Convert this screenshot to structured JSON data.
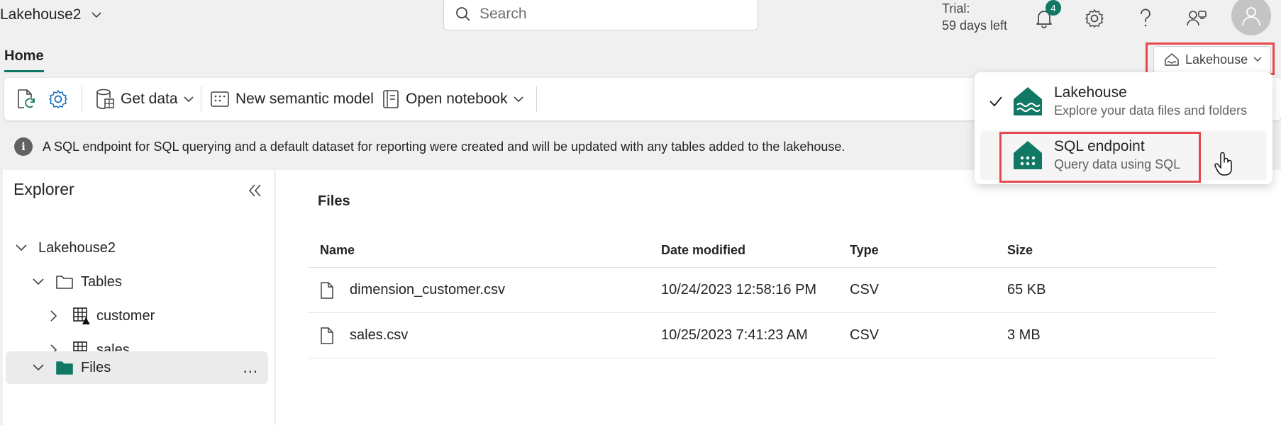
{
  "topbar": {
    "workspace_title": "Lakehouse2",
    "search_placeholder": "Search",
    "trial_line1": "Trial:",
    "trial_line2": "59 days left",
    "notification_count": "4",
    "icons": [
      "bell-icon",
      "gear-icon",
      "help-icon",
      "people-icon",
      "avatar-icon"
    ]
  },
  "tabs": {
    "home": "Home"
  },
  "mode_button": {
    "label": "Lakehouse"
  },
  "ribbon": {
    "get_data": "Get data",
    "new_semantic_model": "New semantic model",
    "open_notebook": "Open notebook"
  },
  "info_bar": {
    "message": "A SQL endpoint for SQL querying and a default dataset for reporting were created and will be updated with any tables added to the lakehouse."
  },
  "explorer": {
    "title": "Explorer",
    "tree": {
      "root": "Lakehouse2",
      "tables": "Tables",
      "table_items": [
        "customer",
        "sales"
      ],
      "files": "Files",
      "more": "..."
    }
  },
  "main": {
    "title": "Files",
    "columns": [
      "Name",
      "Date modified",
      "Type",
      "Size"
    ],
    "rows": [
      {
        "name": "dimension_customer.csv",
        "date": "10/24/2023 12:58:16 PM",
        "type": "CSV",
        "size": "65 KB"
      },
      {
        "name": "sales.csv",
        "date": "10/25/2023 7:41:23 AM",
        "type": "CSV",
        "size": "3 MB"
      }
    ]
  },
  "menu": {
    "items": [
      {
        "title": "Lakehouse",
        "subtitle": "Explore your data files and folders",
        "checked": true
      },
      {
        "title": "SQL endpoint",
        "subtitle": "Query data using SQL",
        "checked": false
      }
    ]
  },
  "colors": {
    "accent": "#117865",
    "highlight": "#e5484d"
  }
}
